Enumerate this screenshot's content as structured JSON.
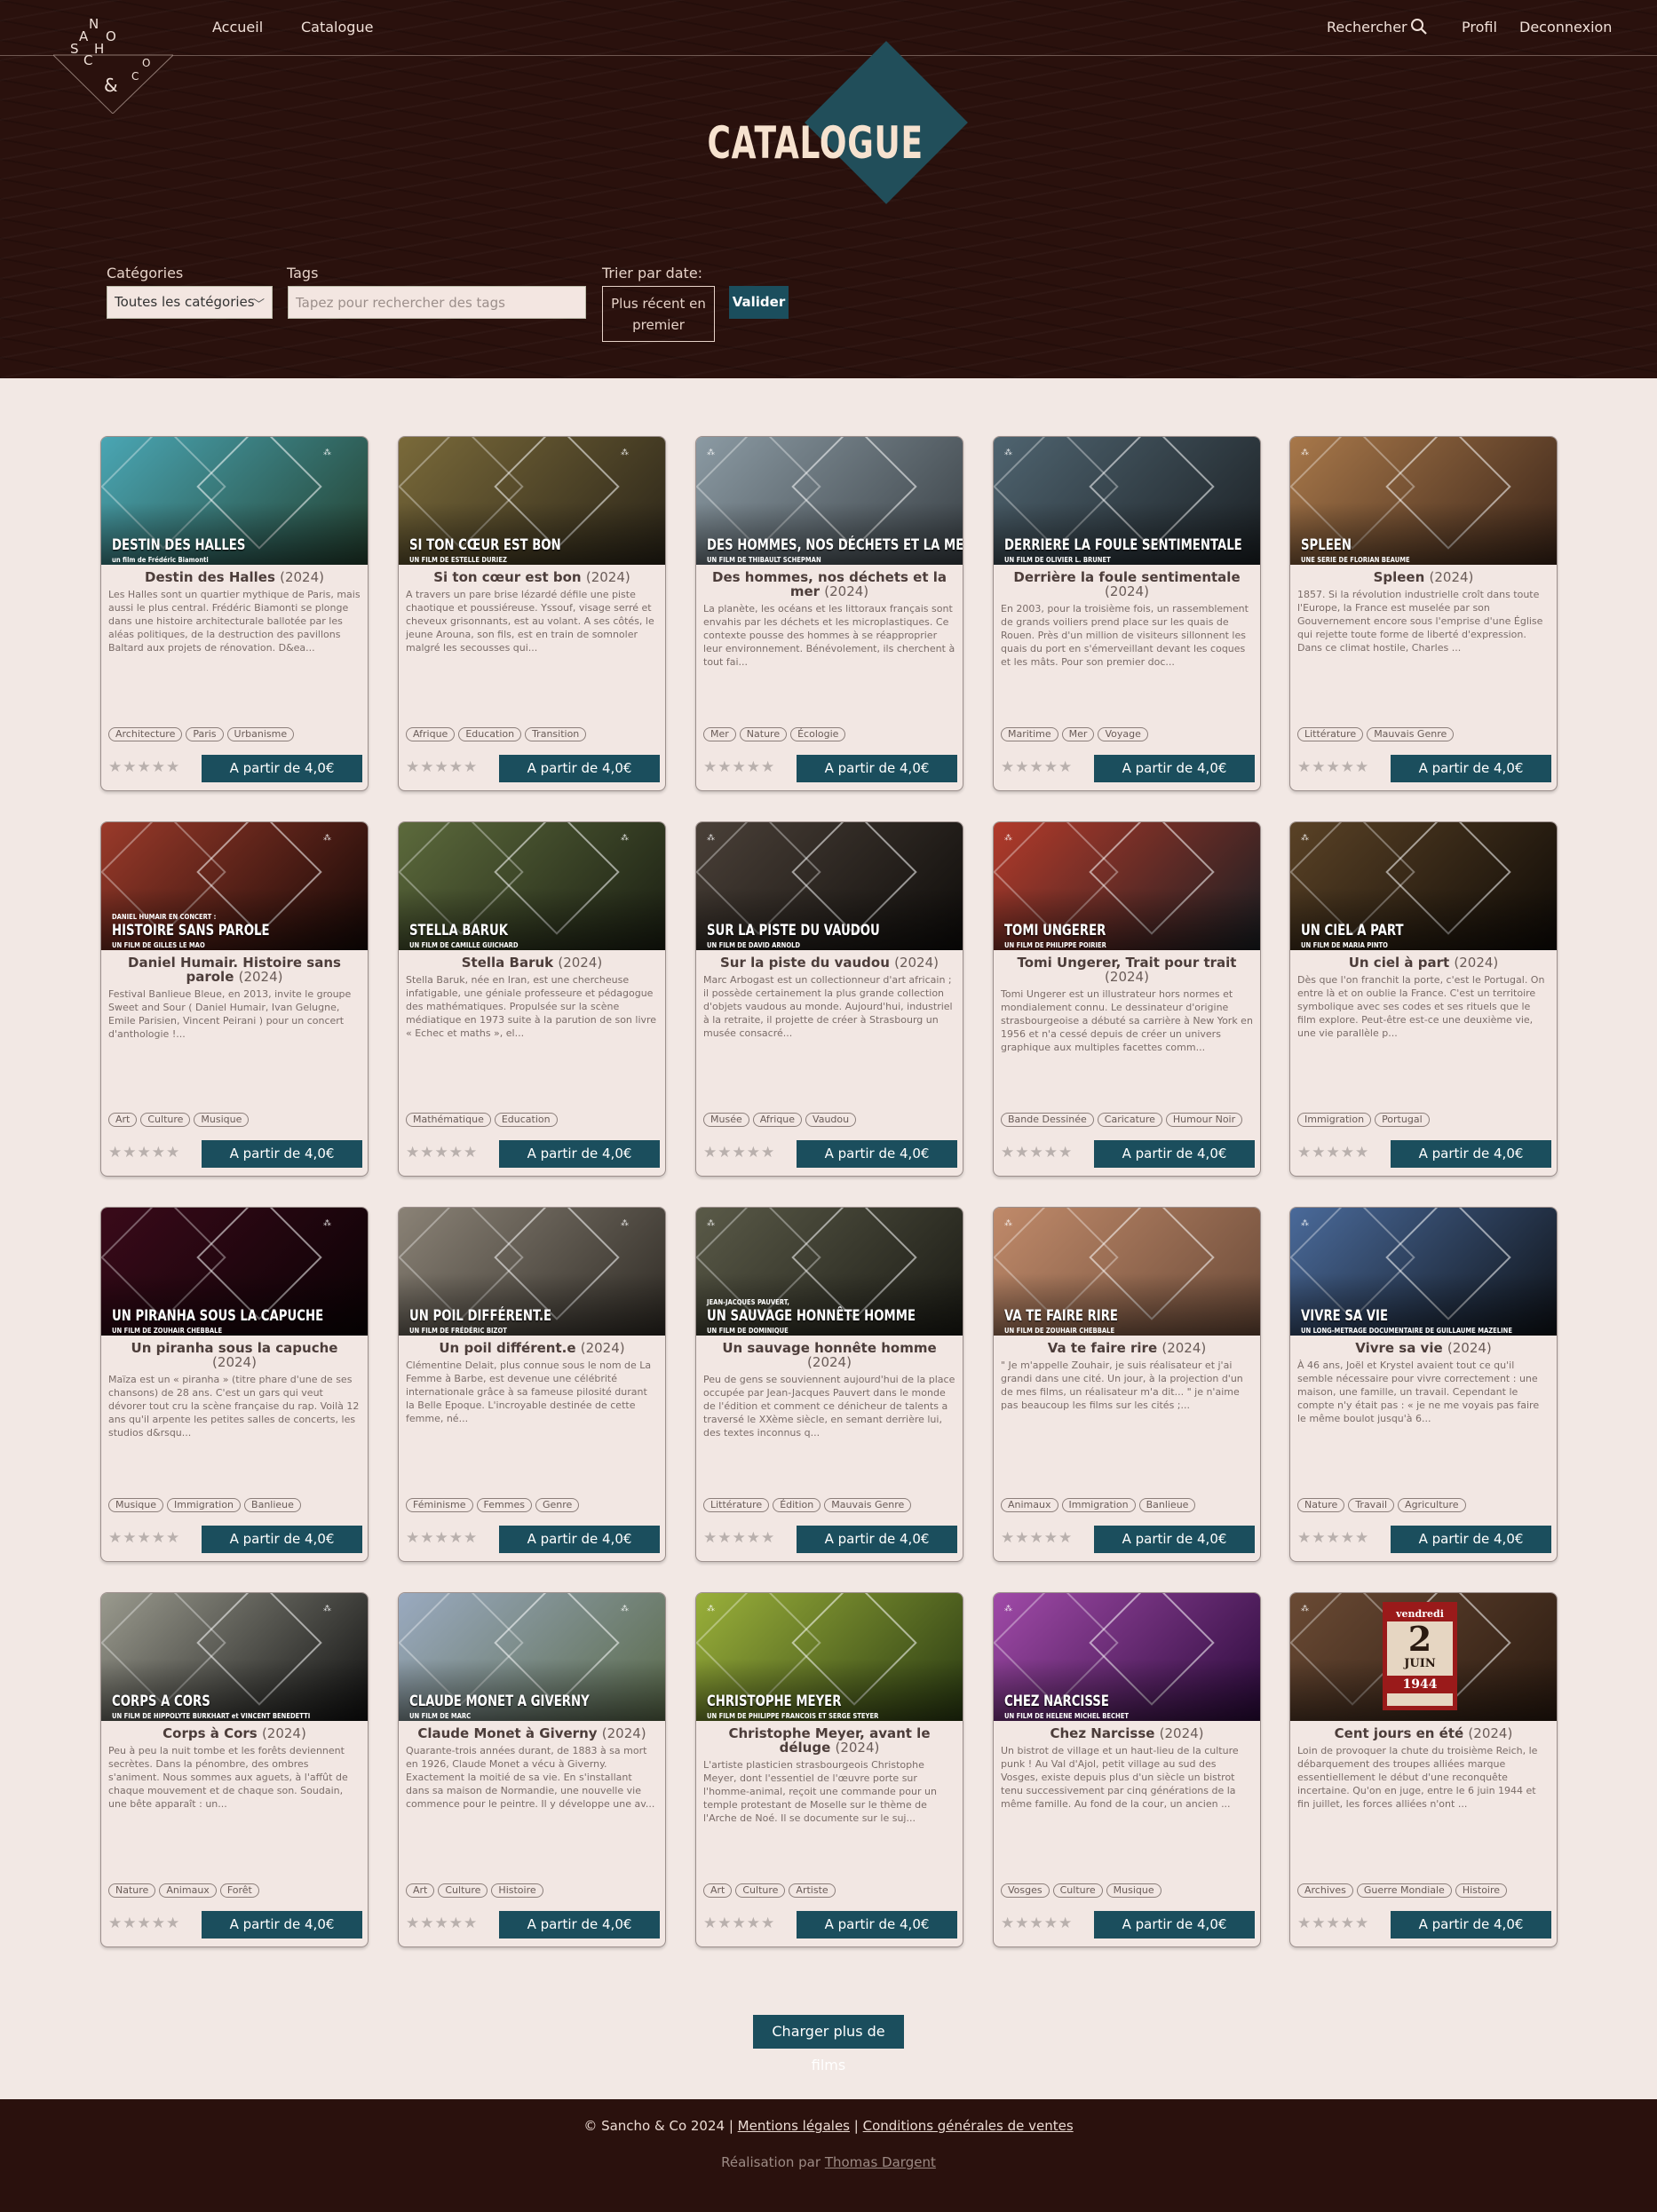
{
  "nav": {
    "home": "Accueil",
    "catalogue": "Catalogue",
    "search": "Rechercher",
    "profile": "Profil",
    "logout": "Deconnexion"
  },
  "logo": {
    "letters": [
      "S",
      "A",
      "N",
      "C",
      "H",
      "O",
      "&",
      "C",
      "O"
    ]
  },
  "page": {
    "title": "CATALOGUE"
  },
  "filters": {
    "category_label": "Catégories",
    "category_value": "Toutes les catégories",
    "tags_label": "Tags",
    "tags_placeholder": "Tapez pour rechercher des tags",
    "sort_label": "Trier par date:",
    "sort_value": "Plus récent en premier",
    "submit": "Valider"
  },
  "films": [
    {
      "title": "Destin des Halles",
      "year": "2024",
      "desc": "Les Halles sont un quartier mythique de Paris, mais aussi le plus central. Frédéric Biamonti se plonge dans une histoire architecturale ballotée par les aléas politiques, de la destruction des pavillons Baltard aux projets de rénovation. D&ea...",
      "tags": [
        "Architecture",
        "Paris",
        "Urbanisme"
      ],
      "price": "A partir de 4,0€",
      "thumb_title": "DESTIN DES HALLES",
      "thumb_sub": "un film de Frédéric Biamonti",
      "colors": [
        "#4aa6b4",
        "#23402f"
      ]
    },
    {
      "title": "Si ton cœur est bon",
      "year": "2024",
      "desc": "A travers un pare brise lézardé défile une piste chaotique et poussiéreuse. Yssouf, visage serré et cheveux grisonnants, est au volant. A ses côtés, le jeune Arouna, son fils, est en train de somnoler malgré les secousses qui...",
      "tags": [
        "Afrique",
        "Education",
        "Transition"
      ],
      "price": "A partir de 4,0€",
      "thumb_title": "SI TON CŒUR EST BON",
      "thumb_sub": "UN FILM DE ESTELLE DURIEZ",
      "colors": [
        "#7a6a3a",
        "#2a2418"
      ]
    },
    {
      "title": "Des hommes, nos déchets et la mer",
      "year": "2024",
      "desc": "La planète, les océans et les littoraux français sont envahis par les déchets et les microplastiques.  Ce contexte pousse des hommes à se réapproprier leur environnement. Bénévolement, ils cherchent à tout fai...",
      "tags": [
        "Mer",
        "Nature",
        "Écologie"
      ],
      "price": "A partir de 4,0€",
      "thumb_title": "DES HOMMES, NOS DÉCHETS ET LA MER",
      "thumb_sub": "UN FILM DE THIBAULT SCHEPMAN",
      "colors": [
        "#8b9aa3",
        "#3a4146"
      ]
    },
    {
      "title": "Derrière la foule sentimentale",
      "year": "2024",
      "desc": "En 2003, pour la troisième fois, un rassemblement de grands voiliers prend place sur les quais de Rouen. Près d'un million de visiteurs sillonnent les quais du port en s'émerveillant devant les coques et les mâts. Pour son premier doc...",
      "tags": [
        "Maritime",
        "Mer",
        "Voyage"
      ],
      "price": "A partir de 4,0€",
      "thumb_title": "DERRIERE LA FOULE SENTIMENTALE",
      "thumb_sub": "UN FILM DE OLIVIER L. BRUNET",
      "colors": [
        "#4f6470",
        "#1b2024"
      ]
    },
    {
      "title": "Spleen",
      "year": "2024",
      "desc": "1857. Si la révolution industrielle croît dans toute l'Europe, la France est muselée par son Gouvernement encore sous l'emprise d'une Église qui rejette toute forme de liberté d'expression. Dans ce climat hostile, Charles ...",
      "tags": [
        "Littérature",
        "Mauvais Genre"
      ],
      "price": "A partir de 4,0€",
      "thumb_title": "SPLEEN",
      "thumb_sub": "UNE SERIE DE FLORIAN BEAUME",
      "colors": [
        "#a8784a",
        "#3a2418"
      ]
    },
    {
      "title": "Daniel Humair. Histoire sans parole",
      "year": "2024",
      "desc": "Festival Banlieue Bleue, en 2013, invite le groupe Sweet and Sour ( Daniel Humair, Ivan Gelugne, Emile Parisien, Vincent Peirani ) pour un concert d'anthologie !...",
      "tags": [
        "Art",
        "Culture",
        "Musique"
      ],
      "price": "A partir de 4,0€",
      "thumb_title": "HISTOIRE SANS PAROLE",
      "thumb_sub": "UN FILM DE GILLES LE MAO",
      "thumb_pre": "DANIEL HUMAIR EN CONCERT :",
      "colors": [
        "#9a3a2a",
        "#140806"
      ]
    },
    {
      "title": "Stella Baruk",
      "year": "2024",
      "desc": "Stella Baruk, née en Iran, est une chercheuse infatigable, une géniale professeure et pédagogue des mathématiques. Propulsée sur la scène médiatique en 1973 suite à la parution de son livre « Echec et maths », el...",
      "tags": [
        "Mathématique",
        "Education"
      ],
      "price": "A partir de 4,0€",
      "thumb_title": "STELLA BARUK",
      "thumb_sub": "UN FILM DE CAMILLE GUICHARD",
      "colors": [
        "#5c6a3c",
        "#1a1e12"
      ]
    },
    {
      "title": "Sur la piste du vaudou",
      "year": "2024",
      "desc": "Marc Arbogast est un collectionneur d'art africain ; il possède certainement la plus grande collection d'objets vaudous au monde. Aujourd'hui, industriel à la retraite, il projette de créer à Strasbourg un musée consacré...",
      "tags": [
        "Musée",
        "Afrique",
        "Vaudou"
      ],
      "price": "A partir de 4,0€",
      "thumb_title": "SUR LA PISTE DU VAUDOU",
      "thumb_sub": "UN FILM DE DAVID ARNOLD",
      "colors": [
        "#4a4038",
        "#0e0c0a"
      ]
    },
    {
      "title": "Tomi Ungerer, Trait pour trait",
      "year": "2024",
      "desc": "Tomi Ungerer est un illustrateur hors normes et mondialement connu. Le dessinateur d'origine strasbourgeoise a débuté sa carrière à New York en 1956 et n'a cessé depuis de créer un univers graphique aux multiples facettes comm...",
      "tags": [
        "Bande Dessinée",
        "Caricature",
        "Humour Noir"
      ],
      "price": "A partir de 4,0€",
      "thumb_title": "TOMI UNGERER",
      "thumb_sub": "UN FILM DE PHILIPPE POIRIER",
      "colors": [
        "#b23a2a",
        "#1a1e22"
      ]
    },
    {
      "title": "Un ciel à part",
      "year": "2024",
      "desc": "Dès que l'on franchit la porte, c'est le Portugal. On entre là et on oublie la France. C'est un territoire symbolique avec ses codes et ses rituels que le film explore. Peut-être est-ce une deuxième vie, une vie parallèle p...",
      "tags": [
        "Immigration",
        "Portugal"
      ],
      "price": "A partir de 4,0€",
      "thumb_title": "UN CIEL A PART",
      "thumb_sub": "UN FILM DE MARIA PINTO",
      "colors": [
        "#5a4226",
        "#0e0a06"
      ]
    },
    {
      "title": "Un piranha sous la capuche",
      "year": "2024",
      "desc": "Maïza est un « piranha » (titre phare d'une de ses chansons) de 28 ans. C'est un gars qui veut dévorer tout cru la scène française du rap. Voilà 12 ans qu'il arpente les petites salles de concerts, les studios d&rsqu...",
      "tags": [
        "Musique",
        "Immigration",
        "Banlieue"
      ],
      "price": "A partir de 4,0€",
      "thumb_title": "UN PIRANHA SOUS LA CAPUCHE",
      "thumb_sub": "UN FILM DE ZOUHAIR CHEBBALE",
      "colors": [
        "#3a0a1a",
        "#0a0204"
      ]
    },
    {
      "title": "Un poil différent.e",
      "year": "2024",
      "desc": "Clémentine Delait, plus connue sous le nom de La Femme à Barbe, est devenue une célébrité internationale grâce à sa fameuse pilosité durant la Belle Epoque. L'incroyable destinée de cette femme, né...",
      "tags": [
        "Féminisme",
        "Femmes",
        "Genre"
      ],
      "price": "A partir de 4,0€",
      "thumb_title": "UN POIL DIFFÉRENT.E",
      "thumb_sub": "UN FILM DE FRÉDÉRIC BIZOT",
      "colors": [
        "#8a8276",
        "#2e2a24"
      ]
    },
    {
      "title": "Un sauvage honnête homme",
      "year": "2024",
      "desc": "Peu de gens se souviennent aujourd'hui de la place occupée par Jean-Jacques Pauvert dans le monde de l'édition et comment ce dénicheur de talents a traversé le XXème siècle, en semant derrière lui, des textes inconnus q...",
      "tags": [
        "Littérature",
        "Édition",
        "Mauvais Genre"
      ],
      "price": "A partir de 4,0€",
      "thumb_title": "UN SAUVAGE HONNÊTE HOMME",
      "thumb_sub": "UN FILM DE DOMINIQUE",
      "thumb_pre": "JEAN-JACQUES PAUVERT,",
      "colors": [
        "#5a5a48",
        "#1a1a14"
      ]
    },
    {
      "title": "Va te faire rire",
      "year": "2024",
      "desc": "\" Je m'appelle Zouhair, je suis réalisateur et j'ai grandi dans une cité. Un jour, à la projection d'un de mes films, un réalisateur m'a dit... \" je n'aime pas beaucoup les films sur les cités ;...",
      "tags": [
        "Animaux",
        "Immigration",
        "Banlieue"
      ],
      "price": "A partir de 4,0€",
      "thumb_title": "VA TE FAIRE RIRE",
      "thumb_sub": "UN FILM DE ZOUHAIR CHEBBALE",
      "colors": [
        "#c08a6a",
        "#6a4a38"
      ]
    },
    {
      "title": "Vivre sa vie",
      "year": "2024",
      "desc": "À 46 ans, Joël et Krystel avaient tout ce qu'il semble nécessaire pour vivre correctement : une maison, une famille, un travail. Cependant le compte n'y était pas : « je ne me voyais pas faire le même boulot jusqu'à 6...",
      "tags": [
        "Nature",
        "Travail",
        "Agriculture"
      ],
      "price": "A partir de 4,0€",
      "thumb_title": "VIVRE SA VIE",
      "thumb_sub": "UN LONG-METRAGE DOCUMENTAIRE DE GUILLAUME MAZELINE",
      "colors": [
        "#4a6a9a",
        "#0e1218"
      ]
    },
    {
      "title": "Corps à Cors",
      "year": "2024",
      "desc": "Peu à peu la nuit tombe et les forêts deviennent secrètes.  Dans la pénombre, des ombres s'animent. Nous sommes aux aguets, à l'affût de chaque mouvement et de chaque son.  Soudain, une bête apparaît : un...",
      "tags": [
        "Nature",
        "Animaux",
        "Forêt"
      ],
      "price": "A partir de 4,0€",
      "thumb_title": "CORPS A CORS",
      "thumb_sub": "UN FILM DE HIPPOLYTE BURKHART et VINCENT BENEDETTI",
      "colors": [
        "#9a9a8e",
        "#101010"
      ]
    },
    {
      "title": "Claude Monet à Giverny",
      "year": "2024",
      "desc": "Quarante-trois années durant, de 1883 à sa mort en 1926, Claude Monet a vécu à Giverny. Exactement la moitié de sa vie. En s'installant dans sa maison de Normandie, une nouvelle vie commence pour le peintre. Il y développe une av...",
      "tags": [
        "Art",
        "Culture",
        "Histoire"
      ],
      "price": "A partir de 4,0€",
      "thumb_title": "CLAUDE MONET A GIVERNY",
      "thumb_sub": "UN FILM DE MARC",
      "colors": [
        "#9aaac0",
        "#5a6a4a"
      ]
    },
    {
      "title": "Christophe Meyer, avant le déluge",
      "year": "2024",
      "desc": "L'artiste plasticien strasbourgeois Christophe Meyer, dont l'essentiel de l'œuvre porte sur l'homme-animal, reçoit une commande pour un temple protestant de Moselle sur le thème de l'Arche de Noé. Il se documente sur le suj...",
      "tags": [
        "Art",
        "Culture",
        "Artiste"
      ],
      "price": "A partir de 4,0€",
      "thumb_title": "CHRISTOPHE MEYER",
      "thumb_sub": "UN FILM DE PHILIPPE FRANCOIS ET SERGE STEYER",
      "colors": [
        "#9ab03a",
        "#2a3a12"
      ]
    },
    {
      "title": "Chez Narcisse",
      "year": "2024",
      "desc": "Un bistrot de village et un haut-lieu de la culture punk ! Au Val d'Ajol, petit village au sud des Vosges, existe depuis plus d'un siècle un bistrot tenu successivement par cinq générations de la même famille. Au fond de la cour, un ancien ...",
      "tags": [
        "Vosges",
        "Culture",
        "Musique"
      ],
      "price": "A partir de 4,0€",
      "thumb_title": "CHEZ NARCISSE",
      "thumb_sub": "UN FILM DE HELENE MICHEL BECHET",
      "colors": [
        "#a04aa8",
        "#2a0a3a"
      ]
    },
    {
      "title": "Cent jours en été",
      "year": "2024",
      "desc": "Loin de provoquer la chute du troisième Reich, le débarquement des troupes alliées marque essentiellement le début d'une reconquête incertaine. Qu'on en juge, entre le 6 juin 1944 et fin juillet, les forces alliées n'ont ...",
      "tags": [
        "Archives",
        "Guerre Mondiale",
        "Histoire"
      ],
      "price": "A partir de 4,0€",
      "thumb_title": "",
      "thumb_sub": "",
      "colors": [
        "#6a4a34",
        "#2a1a10"
      ],
      "calendar": {
        "day": "vendredi",
        "date": "2",
        "month": "JUIN",
        "year": "1944"
      }
    }
  ],
  "load_more": "Charger plus de films",
  "footer": {
    "copyright": "© Sancho & Co 2024 |",
    "legal": "Mentions légales",
    "sep": "|",
    "cgv": "Conditions générales de ventes",
    "made_by": "Réalisation par",
    "author": "Thomas Dargent"
  },
  "colors": {
    "brand_dark": "#2a110d",
    "accent_teal": "#1b4e5d",
    "page_bg": "#f2e8e4"
  },
  "icons": {
    "search": "search-icon",
    "rating": "star-icon"
  }
}
